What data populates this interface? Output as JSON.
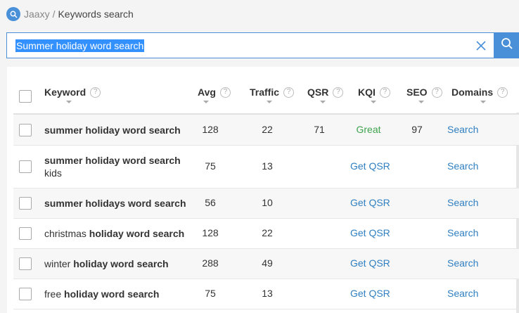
{
  "breadcrumb": {
    "root": "Jaaxy",
    "separator": "/",
    "current": "Keywords search",
    "icon": "search-icon"
  },
  "search": {
    "value": "Summer holiday word search",
    "clear_icon": "close-icon",
    "button_icon": "search-icon"
  },
  "columns": [
    {
      "label": "Keyword",
      "help": "?"
    },
    {
      "label": "Avg",
      "help": "?"
    },
    {
      "label": "Traffic",
      "help": "?"
    },
    {
      "label": "QSR",
      "help": "?"
    },
    {
      "label": "KQI",
      "help": "?"
    },
    {
      "label": "SEO",
      "help": "?"
    },
    {
      "label": "Domains",
      "help": "?"
    }
  ],
  "rows": [
    {
      "keyword_pre": "",
      "keyword_bold": "summer holiday word search",
      "keyword_post": "",
      "avg": "128",
      "traffic": "22",
      "qsr": "71",
      "kqi": "Great",
      "seo": "97",
      "qsr_link": "",
      "domains": "Search"
    },
    {
      "keyword_pre": "",
      "keyword_bold": "summer holiday word search",
      "keyword_post": "kids",
      "avg": "75",
      "traffic": "13",
      "qsr": "",
      "kqi": "",
      "seo": "",
      "qsr_link": "Get QSR",
      "domains": "Search"
    },
    {
      "keyword_pre": "",
      "keyword_bold": "summer holidays word search",
      "keyword_post": "",
      "avg": "56",
      "traffic": "10",
      "qsr": "",
      "kqi": "",
      "seo": "",
      "qsr_link": "Get QSR",
      "domains": "Search"
    },
    {
      "keyword_pre": "christmas ",
      "keyword_bold": "holiday word search",
      "keyword_post": "",
      "avg": "128",
      "traffic": "22",
      "qsr": "",
      "kqi": "",
      "seo": "",
      "qsr_link": "Get QSR",
      "domains": "Search"
    },
    {
      "keyword_pre": "winter ",
      "keyword_bold": "holiday word search",
      "keyword_post": "",
      "avg": "288",
      "traffic": "49",
      "qsr": "",
      "kqi": "",
      "seo": "",
      "qsr_link": "Get QSR",
      "domains": "Search"
    },
    {
      "keyword_pre": "free ",
      "keyword_bold": "holiday word search",
      "keyword_post": "",
      "avg": "75",
      "traffic": "13",
      "qsr": "",
      "kqi": "",
      "seo": "",
      "qsr_link": "Get QSR",
      "domains": "Search"
    }
  ],
  "colors": {
    "accent": "#4a90d9",
    "link": "#2f7fc1",
    "great": "#3fa34d"
  }
}
